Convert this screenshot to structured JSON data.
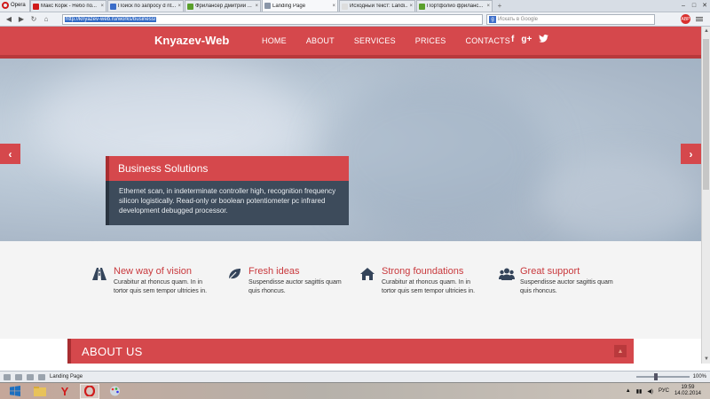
{
  "browser": {
    "menu_label": "Opera",
    "tabs": [
      {
        "title": "Макс Корж - Небо по...",
        "fav_color": "#d01a1a"
      },
      {
        "title": "Поиск по запросу d nt...",
        "fav_color": "#3b6dc9"
      },
      {
        "title": "Фрилансер Дмитрий ...",
        "fav_color": "#5aa02c"
      },
      {
        "title": "Landing Page",
        "fav_color": "#8a96a8"
      },
      {
        "title": "Исходный текст: Landi...",
        "fav_color": "#dddddd"
      },
      {
        "title": "Портфолио фриланс...",
        "fav_color": "#5aa02c"
      }
    ],
    "active_tab_index": 3,
    "url": "http://knyazev-web.ru/works/business/",
    "search_placeholder": "Искать в Google",
    "status_page_title": "Landing Page",
    "zoom_value": "100%"
  },
  "site": {
    "logo": "Knyazev-Web",
    "nav": [
      "HOME",
      "ABOUT",
      "SERVICES",
      "PRICES",
      "CONTACTS"
    ],
    "social": [
      "f",
      "g+",
      "t"
    ],
    "accent": "#d5484c",
    "hero": {
      "title": "Business Solutions",
      "text": "Ethernet scan, in indeterminate controller high, recognition frequency silicon logistically. Read-only or boolean potentiometer pc infrared development debugged processor."
    },
    "features": [
      {
        "title": "New way of vision",
        "text": "Curabitur at rhoncus quam. In in tortor quis sem tempor ultricies in.",
        "icon": "road-icon"
      },
      {
        "title": "Fresh ideas",
        "text": "Suspendisse auctor sagittis quam quis rhoncus.",
        "icon": "leaf-icon"
      },
      {
        "title": "Strong foundations",
        "text": "Curabitur at rhoncus quam. In in tortor quis sem tempor ultricies in.",
        "icon": "home-icon"
      },
      {
        "title": "Great support",
        "text": "Suspendisse auctor sagittis quam quis rhoncus.",
        "icon": "group-icon"
      }
    ],
    "about_title": "ABOUT US"
  },
  "taskbar": {
    "lang": "РУС",
    "time": "19:59",
    "date": "14.02.2014"
  }
}
